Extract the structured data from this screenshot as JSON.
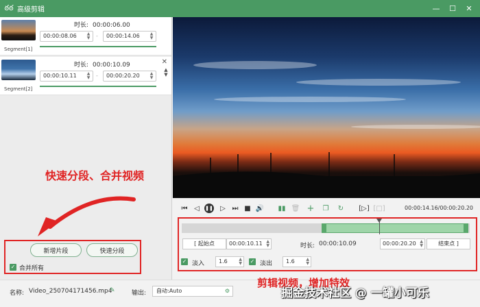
{
  "window": {
    "title": "高级剪辑",
    "minimize": "—",
    "maximize": "☐",
    "close": "✕"
  },
  "segments": [
    {
      "label": "Segment[1]",
      "duration_label": "时长:",
      "duration": "00:00:06.00",
      "start": "00:00:08.06",
      "end": "00:00:14.06"
    },
    {
      "label": "Segment[2]",
      "duration_label": "时长:",
      "duration": "00:00:10.09",
      "start": "00:00:10.11",
      "end": "00:00:20.20"
    }
  ],
  "annotations": {
    "left": "快速分段、合并视频",
    "right": "剪辑视频，增加特效"
  },
  "left_buttons": {
    "add_segment": "新增片段",
    "quick_split": "快速分段",
    "merge_all": "合并所有"
  },
  "player": {
    "time": "00:00:14.16/00:00:20.20"
  },
  "edit": {
    "start_button": "[ 起始点",
    "start_time": "00:00:10.11",
    "duration_label": "时长:",
    "duration": "00:00:10.09",
    "end_time": "00:00:20.20",
    "end_button": "结束点 ]",
    "fade_in_label": "淡入",
    "fade_in": "1.6",
    "fade_out_label": "淡出",
    "fade_out": "1.6",
    "selection": {
      "start": 0.5,
      "end": 1.0,
      "playhead": 0.7
    }
  },
  "bottom": {
    "name_label": "名称:",
    "name": "Video_250704171456.mp4",
    "output_label": "输出:",
    "output": "自动:Auto"
  },
  "watermark": "掘金技术社区 @ 一罐小可乐",
  "colors": {
    "accent": "#4a9a63",
    "annotation": "#e02424"
  }
}
